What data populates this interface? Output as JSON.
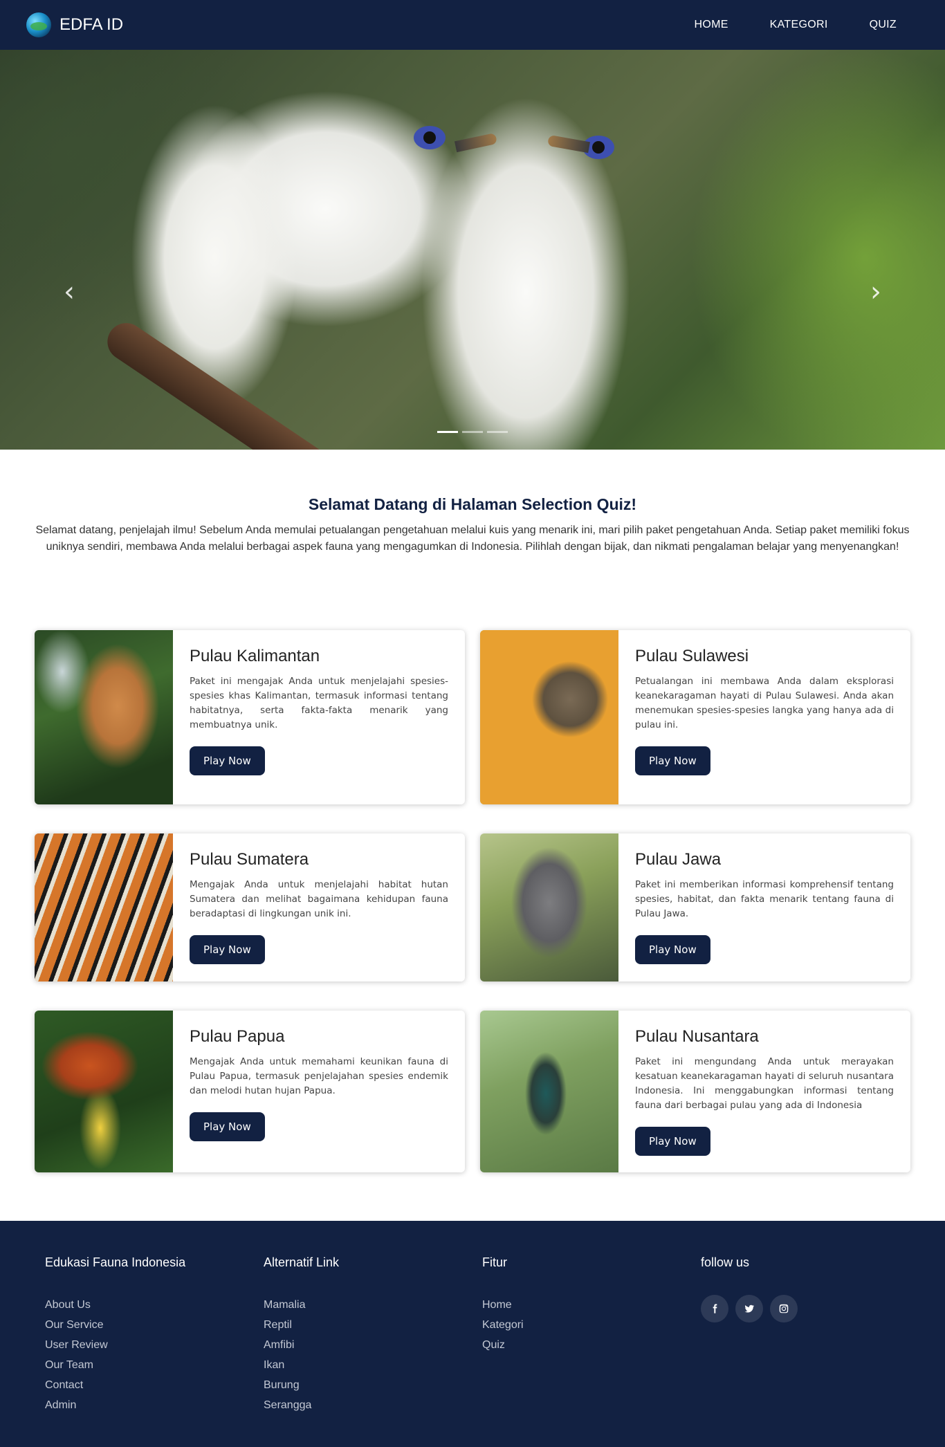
{
  "brand": {
    "name": "EDFA ID",
    "logo_icon": "globe-logo-icon"
  },
  "nav": {
    "links": [
      {
        "label": "HOME"
      },
      {
        "label": "KATEGORI"
      },
      {
        "label": "QUIZ"
      }
    ]
  },
  "carousel": {
    "prev_icon": "chevron-left-icon",
    "next_icon": "chevron-right-icon",
    "prev_glyph": "‹",
    "next_glyph": "›",
    "slide_count": 3,
    "active_slide": 1,
    "image_subject": "two white Bali starlings perched on a branch"
  },
  "intro": {
    "title": "Selamat Datang di Halaman Selection Quiz!",
    "text": "Selamat datang, penjelajah ilmu! Sebelum Anda memulai petualangan pengetahuan melalui kuis yang menarik ini, mari pilih paket pengetahuan Anda. Setiap paket memiliki fokus uniknya sendiri, membawa Anda melalui berbagai aspek fauna yang mengagumkan di Indonesia. Pilihlah dengan bijak, dan nikmati pengalaman belajar yang menyenangkan!"
  },
  "cards": [
    {
      "title": "Pulau Kalimantan",
      "text": "Paket ini mengajak Anda untuk menjelajahi spesies-spesies khas Kalimantan, termasuk informasi tentang habitatnya, serta fakta-fakta menarik yang membuatnya unik.",
      "button": "Play Now"
    },
    {
      "title": "Pulau Sulawesi",
      "text": "Petualangan ini membawa Anda dalam eksplorasi keanekaragaman hayati di Pulau Sulawesi. Anda akan menemukan spesies-spesies langka yang hanya ada di pulau ini.",
      "button": "Play Now"
    },
    {
      "title": "Pulau Sumatera",
      "text": "Mengajak Anda untuk menjelajahi habitat hutan Sumatera dan melihat bagaimana kehidupan fauna beradaptasi di lingkungan unik ini.",
      "button": "Play Now"
    },
    {
      "title": "Pulau Jawa",
      "text": "Paket ini memberikan informasi komprehensif tentang spesies, habitat, dan fakta menarik tentang fauna di Pulau Jawa.",
      "button": "Play Now"
    },
    {
      "title": "Pulau Papua",
      "text": "Mengajak Anda untuk memahami keunikan fauna di Pulau Papua, termasuk penjelajahan spesies endemik dan melodi hutan hujan Papua.",
      "button": "Play Now"
    },
    {
      "title": "Pulau Nusantara",
      "text": "Paket ini mengundang Anda untuk merayakan kesatuan keanekaragaman hayati di seluruh nusantara Indonesia. Ini menggabungkan informasi tentang fauna dari berbagai pulau yang ada di Indonesia",
      "button": "Play Now"
    }
  ],
  "footer": {
    "col1": {
      "heading": "Edukasi Fauna Indonesia",
      "links": [
        "About Us",
        "Our Service",
        "User Review",
        "Our Team",
        "Contact",
        "Admin"
      ]
    },
    "col2": {
      "heading": "Alternatif Link",
      "links": [
        "Mamalia",
        "Reptil",
        "Amfibi",
        "Ikan",
        "Burung",
        "Serangga"
      ]
    },
    "col3": {
      "heading": "Fitur",
      "links": [
        "Home",
        "Kategori",
        "Quiz"
      ]
    },
    "col4": {
      "heading": "follow us",
      "socials": [
        "facebook-icon",
        "twitter-icon",
        "instagram-icon"
      ]
    }
  },
  "colors": {
    "primary": "#122142",
    "text": "#333333",
    "footer_link": "#c4c9d4",
    "social_bg": "#2d3a57"
  }
}
